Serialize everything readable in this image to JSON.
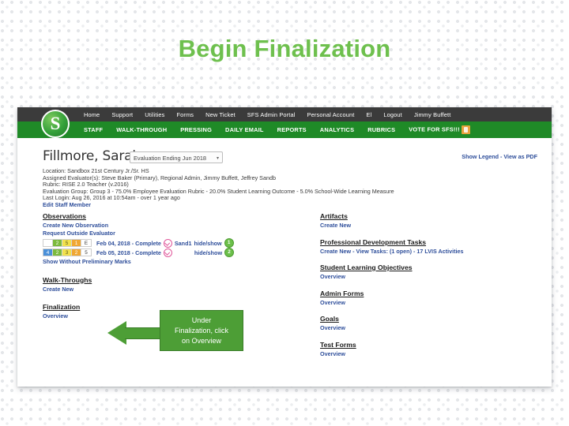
{
  "slide": {
    "title": "Begin Finalization",
    "title_color": "#6ec04e"
  },
  "screenshot": {
    "top_nav": {
      "background": "#3b3b3b",
      "items": [
        "Home",
        "Support",
        "Utilities",
        "Forms",
        "New Ticket",
        "SFS Admin Portal",
        "Personal Account",
        "El",
        "Logout",
        "Jimmy Buffett"
      ]
    },
    "secondary_nav": {
      "background": "#1f8a27",
      "items": [
        "STAFF",
        "WALK-THROUGH",
        "PRESSING",
        "DAILY EMAIL",
        "REPORTS",
        "ANALYTICS",
        "RUBRICS",
        "VOTE FOR SFS!!!"
      ]
    },
    "logo": {
      "letter": "S"
    },
    "header": {
      "staff_name": "Fillmore, Sarah",
      "evaluation_select": "Evaluation Ending Jun 2018",
      "evaluation_caret": "▾",
      "legend_links": "Show Legend - View as PDF"
    },
    "meta": {
      "location": "Location: Sandbox 21st Century Jr./Sr. HS",
      "evaluators": "Assigned Evaluator(s): Steve Baker (Primary), Regional Admin, Jimmy Buffett, Jeffrey Sandb",
      "rubric": "Rubric: RISE 2.0 Teacher (v.2016)",
      "evaluation_group": "Evaluation Group: Group 3 - 75.0% Employee Evaluation Rubric - 20.0% Student Learning Outcome - 5.0% School-Wide Learning Measure",
      "last_login": "Last Login: Aug 26, 2016 at 10:54am - over 1 year ago",
      "edit_link": "Edit Staff Member"
    },
    "left_column": {
      "observations": {
        "title": "Observations",
        "create_link": "Create New Observation",
        "request_link": "Request Outside Evaluator",
        "rows": [
          {
            "marks": [
              {
                "value": "",
                "color": "blank"
              },
              {
                "value": "2",
                "color": "green"
              },
              {
                "value": "5",
                "color": "yellow"
              },
              {
                "value": "1",
                "color": "orange"
              },
              {
                "value": "E",
                "color": "blank"
              }
            ],
            "date": "Feb 04, 2018 - Complete",
            "evaluator": "Sand1",
            "toggle": "hide/show",
            "badge": "1"
          },
          {
            "marks": [
              {
                "value": "4",
                "color": "blue"
              },
              {
                "value": "2",
                "color": "green"
              },
              {
                "value": "3",
                "color": "yellow"
              },
              {
                "value": "2",
                "color": "orange"
              },
              {
                "value": "5",
                "color": "blank"
              }
            ],
            "date": "Feb 05, 2018 - Complete",
            "evaluator": "",
            "toggle": "hide/show",
            "badge": "2"
          }
        ],
        "show_without_link": "Show Without Preliminary Marks"
      },
      "walkthroughs": {
        "title": "Walk-Throughs",
        "link": "Create New"
      },
      "finalization": {
        "title": "Finalization",
        "link": "Overview"
      }
    },
    "right_column": {
      "sections": [
        {
          "title": "Artifacts",
          "link": "Create New"
        },
        {
          "title": "Professional Development Tasks",
          "link": "Create New - View Tasks: (1 open) - 17 LVIS Activities"
        },
        {
          "title": "Student Learning Objectives",
          "link": "Overview"
        },
        {
          "title": "Admin Forms",
          "link": "Overview"
        },
        {
          "title": "Goals",
          "link": "Overview"
        },
        {
          "title": "Test Forms",
          "link": "Overview"
        }
      ]
    },
    "callout": {
      "line1": "Under",
      "line2": "Finalization, click",
      "line3": "on Overview",
      "color": "#4d9e36"
    }
  }
}
